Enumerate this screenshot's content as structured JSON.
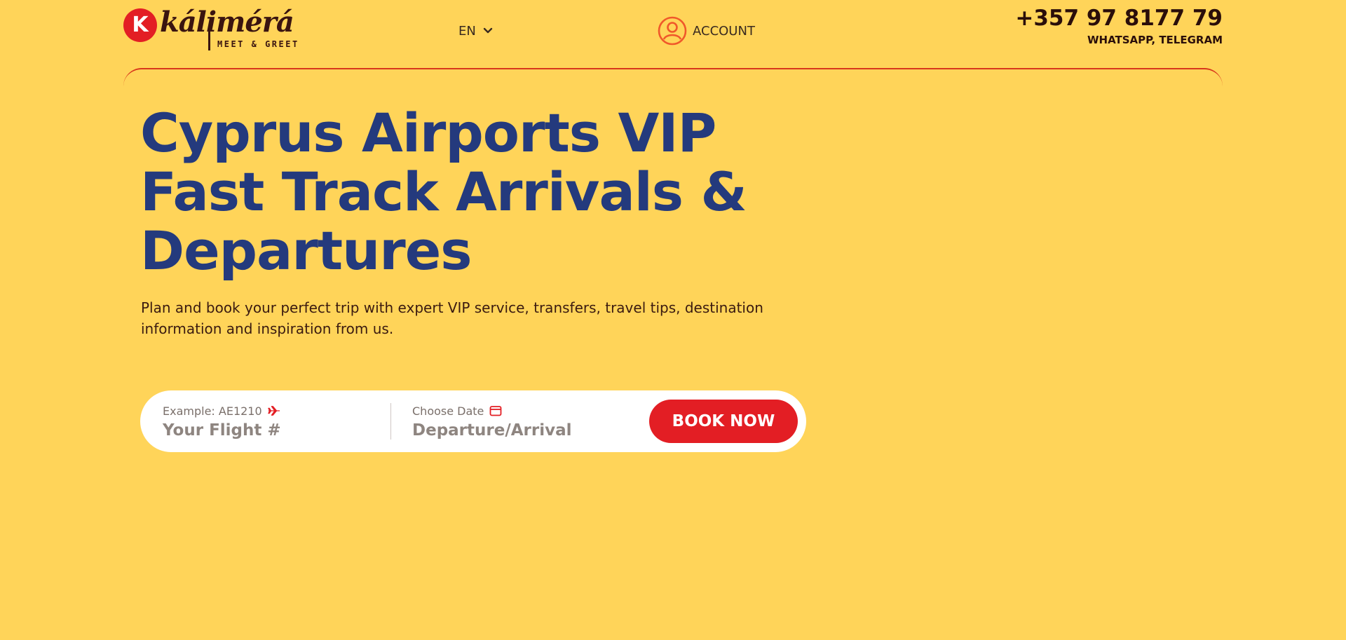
{
  "header": {
    "logo": {
      "badge_letter": "K",
      "wordmark": "kálimérá",
      "tagline": "MEET & GREET"
    },
    "language": {
      "selected": "EN"
    },
    "account": {
      "label": "ACCOUNT"
    },
    "contact": {
      "phone": "+357 97 8177 79",
      "channels": [
        "WHATSAPP",
        "TELEGRAM"
      ],
      "separator": ", "
    }
  },
  "hero": {
    "title": "Cyprus Airports VIP Fast Track Arrivals & Departures",
    "subtitle": "Plan and book your perfect trip with expert VIP service, transfers, travel tips, destination information and inspiration from us."
  },
  "booking": {
    "flight": {
      "label": "Example: AE1210",
      "placeholder": "Your Flight #"
    },
    "date": {
      "label": "Choose Date",
      "placeholder": "Departure/Arrival"
    },
    "submit_label": "BOOK NOW"
  },
  "colors": {
    "background": "#ffd459",
    "brand_red": "#e31e24",
    "title_blue": "#243a7d",
    "account_orange": "#f0582a"
  },
  "icons": {
    "language_chevron": "chevron-down-icon",
    "account": "user-circle-icon",
    "flight": "airplane-icon",
    "date": "calendar-icon"
  }
}
